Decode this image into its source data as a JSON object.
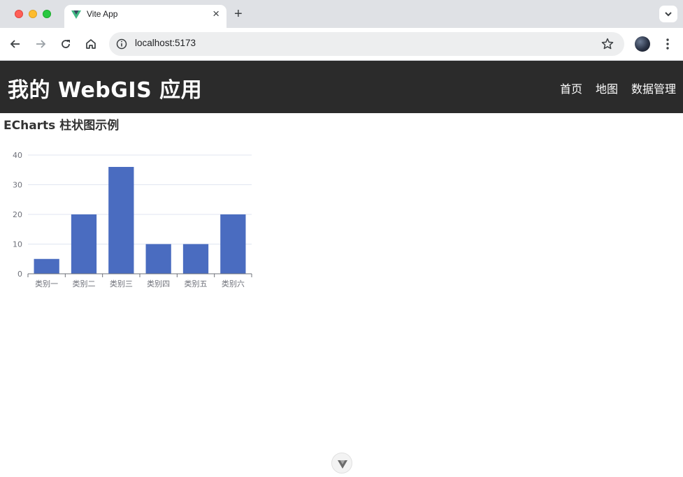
{
  "browser": {
    "tab_title": "Vite App",
    "tab_close": "×",
    "new_tab": "+",
    "url": "localhost:5173"
  },
  "header": {
    "title": "我的 WebGIS 应用",
    "nav": [
      "首页",
      "地图",
      "数据管理"
    ]
  },
  "section": {
    "heading": "ECharts 柱状图示例"
  },
  "chart_data": {
    "type": "bar",
    "categories": [
      "类别一",
      "类别二",
      "类别三",
      "类别四",
      "类别五",
      "类别六"
    ],
    "values": [
      5,
      20,
      36,
      10,
      10,
      20
    ],
    "ylim": [
      0,
      40
    ],
    "yticks": [
      0,
      10,
      20,
      30,
      40
    ],
    "grid": true,
    "bar_color": "#4a6cc0"
  },
  "colors": {
    "header_bg": "#2b2b2b",
    "bar": "#4a6cc0"
  }
}
